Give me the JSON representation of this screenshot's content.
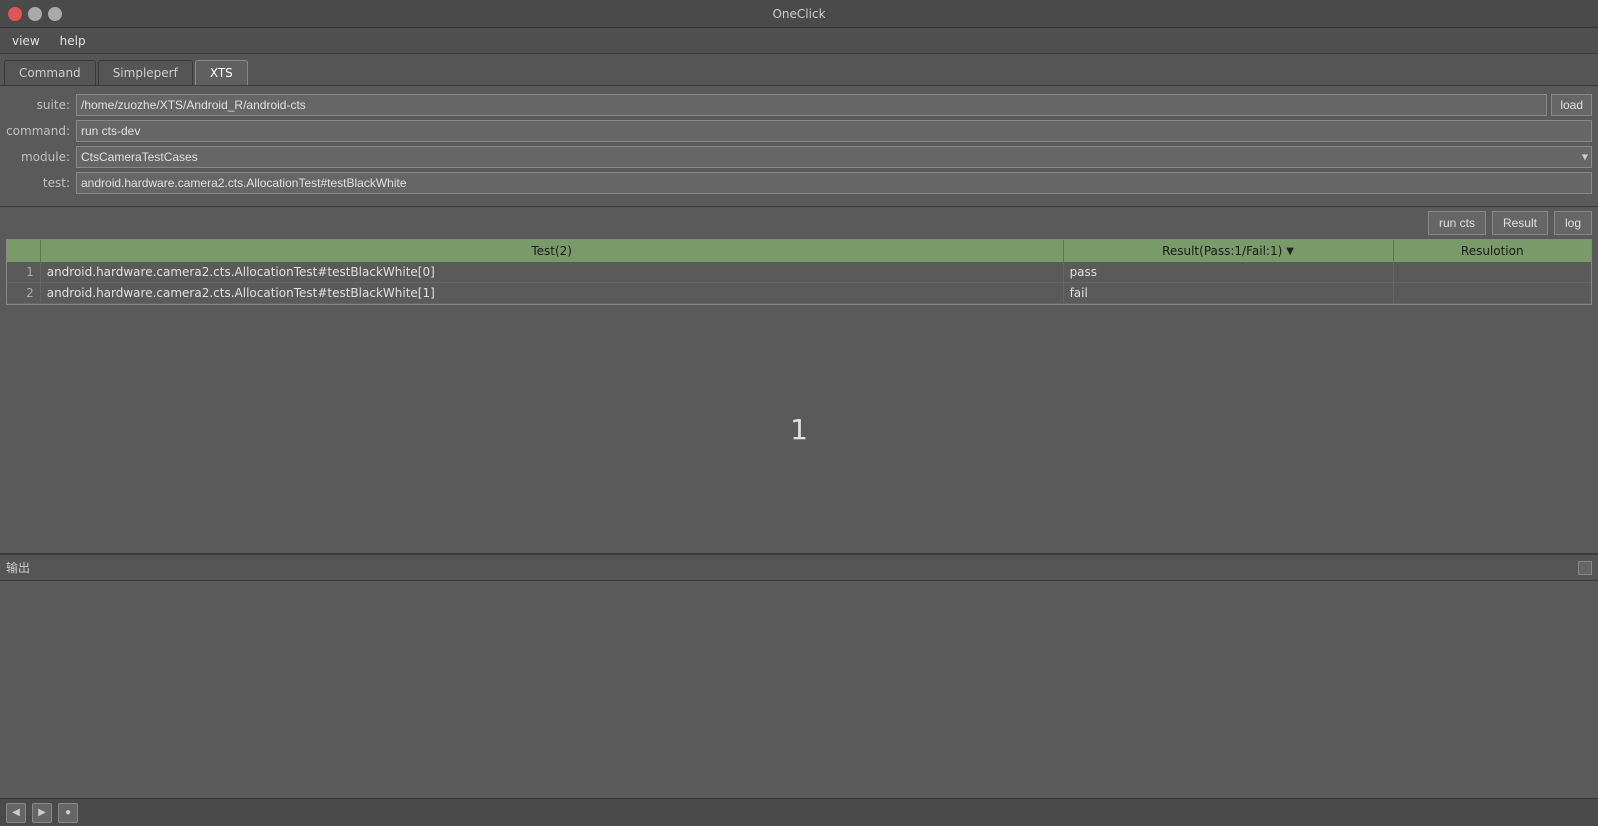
{
  "window": {
    "title": "OneClick"
  },
  "menu": {
    "items": [
      {
        "id": "view",
        "label": "view"
      },
      {
        "id": "help",
        "label": "help"
      }
    ]
  },
  "tabs": [
    {
      "id": "command",
      "label": "Command",
      "active": false
    },
    {
      "id": "simpleperf",
      "label": "Simpleperf",
      "active": false
    },
    {
      "id": "xts",
      "label": "XTS",
      "active": true
    }
  ],
  "form": {
    "suite_label": "suite:",
    "suite_value": "/home/zuozhe/XTS/Android_R/android-cts",
    "suite_placeholder": "",
    "load_label": "load",
    "command_label": "command:",
    "command_value": "run cts-dev",
    "module_label": "module:",
    "module_value": "CtsCameraTestCases",
    "test_label": "test:",
    "test_value": "android.hardware.camera2.cts.AllocationTest#testBlackWhite"
  },
  "toolbar": {
    "run_cts_label": "run cts",
    "result_label": "Result",
    "log_label": "log"
  },
  "table": {
    "col_test": "Test(2)",
    "col_result": "Result(Pass:1/Fail:1)",
    "col_resolution": "Resulotion",
    "rows": [
      {
        "num": "1",
        "test": "android.hardware.camera2.cts.AllocationTest#testBlackWhite[0]",
        "result": "pass",
        "resolution": ""
      },
      {
        "num": "2",
        "test": "android.hardware.camera2.cts.AllocationTest#testBlackWhite[1]",
        "result": "fail",
        "resolution": ""
      }
    ]
  },
  "page_indicator": "1",
  "output": {
    "title": "输出",
    "content": ""
  },
  "status_bar": {
    "btns": [
      "◀",
      "▶",
      "●"
    ]
  }
}
